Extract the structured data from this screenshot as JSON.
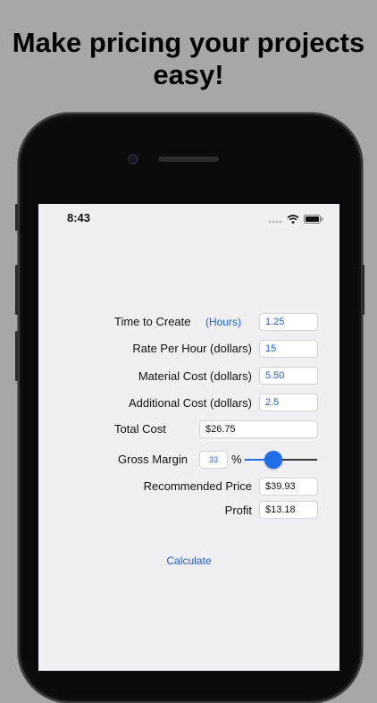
{
  "headline": "Make pricing your projects easy!",
  "status_bar": {
    "time": "8:43"
  },
  "form": {
    "time_label": "Time to Create",
    "hours_link": "(Hours)",
    "time_value": "1.25",
    "rate_label": "Rate Per Hour (dollars)",
    "rate_value": "15",
    "material_label": "Material Cost (dollars)",
    "material_value": "5.50",
    "additional_label": "Additional Cost (dollars)",
    "additional_value": "2.5",
    "total_label": "Total Cost",
    "total_value": "$26.75",
    "margin_label": "Gross Margin",
    "margin_value": "33",
    "percent_sign": "%",
    "margin_slider_fraction": 0.4,
    "recommended_label": "Recommended Price",
    "recommended_value": "$39.93",
    "profit_label": "Profit",
    "profit_value": "$13.18",
    "calculate_label": "Calculate"
  },
  "colors": {
    "accent": "#1f6ee8",
    "background": "#a7a7a7",
    "screen": "#efeff4"
  }
}
